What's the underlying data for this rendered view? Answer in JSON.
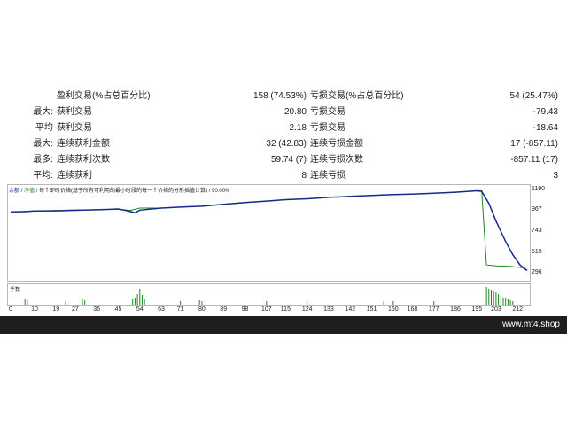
{
  "stats": [
    {
      "prefix": "",
      "label1": "盈利交易(%占总百分比)",
      "value1": "158 (74.53%)",
      "label2": "亏损交易(%占总百分比)",
      "value2": "54 (25.47%)"
    },
    {
      "prefix": "最大:",
      "label1": "获利交易",
      "value1": "20.80",
      "label2": "亏损交易",
      "value2": "-79.43"
    },
    {
      "prefix": "平均",
      "label1": "获利交易",
      "value1": "2.18",
      "label2": "亏损交易",
      "value2": "-18.64"
    },
    {
      "prefix": "最大:",
      "label1": "连续获利金额",
      "value1": "32 (42.83)",
      "label2": "连续亏损金额",
      "value2": "17 (-857.11)"
    },
    {
      "prefix": "最多:",
      "label1": "连续获利次数",
      "value1": "59.74 (7)",
      "label2": "连续亏损次数",
      "value2": "-857.11 (17)"
    },
    {
      "prefix": "平均:",
      "label1": "连续获利",
      "value1": "8",
      "label2": "连续亏损",
      "value2": "3"
    }
  ],
  "chart": {
    "legend_balance": "余额",
    "legend_sep": " / ",
    "legend_equity": "净值",
    "legend_rest": " / 每个即时价格(基于所有可利用的最小时段的每一个价格的分形插值计算) / 90.00%",
    "volume_label": "手数",
    "colors": {
      "balance": "#1a2a8a",
      "equity": "#1a8a1a",
      "volume": "#1a8a1a"
    }
  },
  "chart_data": {
    "type": "line",
    "xlim": [
      0,
      216
    ],
    "ylim": [
      296,
      1190
    ],
    "y_ticks": [
      "1190",
      "967",
      "743",
      "519",
      "296"
    ],
    "x_ticks": [
      "0",
      "10",
      "19",
      "27",
      "36",
      "45",
      "54",
      "63",
      "71",
      "80",
      "89",
      "98",
      "107",
      "115",
      "124",
      "133",
      "142",
      "151",
      "160",
      "168",
      "177",
      "186",
      "195",
      "203",
      "212"
    ],
    "series": [
      {
        "points": [
          [
            0,
            960
          ],
          [
            6,
            962
          ],
          [
            10,
            968
          ],
          [
            19,
            970
          ],
          [
            27,
            976
          ],
          [
            36,
            982
          ],
          [
            45,
            990
          ],
          [
            49,
            970
          ],
          [
            52,
            950
          ],
          [
            54,
            978
          ],
          [
            63,
            1000
          ],
          [
            71,
            1010
          ],
          [
            80,
            1020
          ],
          [
            89,
            1040
          ],
          [
            98,
            1060
          ],
          [
            107,
            1075
          ],
          [
            115,
            1090
          ],
          [
            124,
            1100
          ],
          [
            133,
            1115
          ],
          [
            142,
            1125
          ],
          [
            151,
            1135
          ],
          [
            160,
            1145
          ],
          [
            168,
            1150
          ],
          [
            177,
            1160
          ],
          [
            186,
            1170
          ],
          [
            195,
            1185
          ],
          [
            197,
            1180
          ],
          [
            200,
            1050
          ],
          [
            203,
            860
          ],
          [
            207,
            640
          ],
          [
            210,
            500
          ],
          [
            213,
            390
          ],
          [
            216,
            330
          ]
        ]
      },
      {
        "points": [
          [
            0,
            960
          ],
          [
            10,
            968
          ],
          [
            27,
            980
          ],
          [
            36,
            982
          ],
          [
            45,
            988
          ],
          [
            50,
            975
          ],
          [
            54,
            1000
          ],
          [
            63,
            1000
          ],
          [
            71,
            1012
          ],
          [
            80,
            1022
          ],
          [
            89,
            1040
          ],
          [
            98,
            1060
          ],
          [
            107,
            1075
          ],
          [
            115,
            1090
          ],
          [
            124,
            1100
          ],
          [
            133,
            1115
          ],
          [
            142,
            1125
          ],
          [
            151,
            1135
          ],
          [
            160,
            1145
          ],
          [
            168,
            1150
          ],
          [
            177,
            1160
          ],
          [
            186,
            1170
          ],
          [
            195,
            1186
          ],
          [
            197,
            1186
          ],
          [
            199,
            390
          ],
          [
            203,
            380
          ],
          [
            209,
            375
          ],
          [
            214,
            360
          ],
          [
            216,
            330
          ]
        ]
      }
    ],
    "volume_bars": [
      [
        6,
        0.3
      ],
      [
        7,
        0.25
      ],
      [
        23,
        0.2
      ],
      [
        30,
        0.3
      ],
      [
        31,
        0.25
      ],
      [
        51,
        0.3
      ],
      [
        52,
        0.4
      ],
      [
        53,
        0.6
      ],
      [
        54,
        0.9
      ],
      [
        55,
        0.55
      ],
      [
        56,
        0.3
      ],
      [
        71,
        0.2
      ],
      [
        79,
        0.25
      ],
      [
        80,
        0.2
      ],
      [
        107,
        0.2
      ],
      [
        124,
        0.2
      ],
      [
        156,
        0.2
      ],
      [
        160,
        0.2
      ],
      [
        177,
        0.2
      ],
      [
        199,
        1.0
      ],
      [
        200,
        0.9
      ],
      [
        201,
        0.8
      ],
      [
        202,
        0.75
      ],
      [
        203,
        0.7
      ],
      [
        204,
        0.6
      ],
      [
        205,
        0.5
      ],
      [
        206,
        0.4
      ],
      [
        207,
        0.35
      ],
      [
        208,
        0.3
      ],
      [
        209,
        0.25
      ],
      [
        210,
        0.2
      ]
    ]
  },
  "footer": {
    "text": "www.mt4.shop"
  }
}
